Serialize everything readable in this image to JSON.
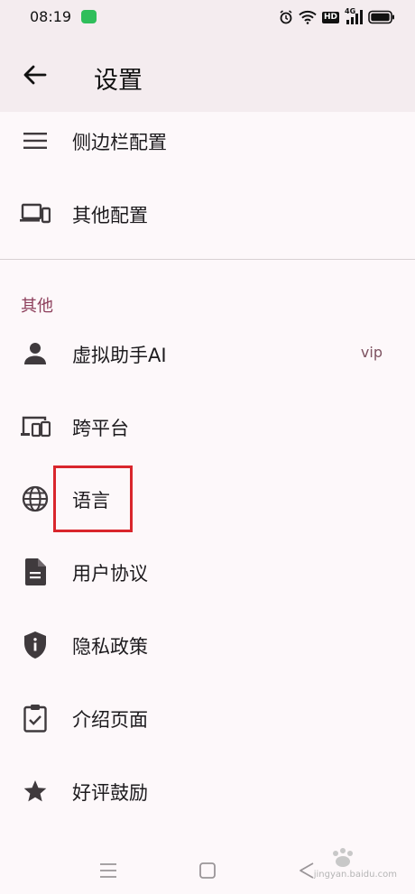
{
  "status_bar": {
    "time": "08:19",
    "hd_badge": "HD",
    "network": "4G"
  },
  "app_bar": {
    "title": "设置"
  },
  "items_top": [
    {
      "label": "侧边栏配置",
      "icon": "menu-icon"
    },
    {
      "label": "其他配置",
      "icon": "devices-icon"
    }
  ],
  "section": {
    "title": "其他"
  },
  "items": [
    {
      "label": "虚拟助手AI",
      "icon": "person-icon",
      "trailing": "vip"
    },
    {
      "label": "跨平台",
      "icon": "multi-device-icon"
    },
    {
      "label": "语言",
      "icon": "globe-icon"
    },
    {
      "label": "用户协议",
      "icon": "document-icon"
    },
    {
      "label": "隐私政策",
      "icon": "shield-icon"
    },
    {
      "label": "介绍页面",
      "icon": "clipboard-check-icon"
    },
    {
      "label": "好评鼓励",
      "icon": "star-icon"
    }
  ],
  "watermark": {
    "text": "jingyan.baidu.com"
  }
}
